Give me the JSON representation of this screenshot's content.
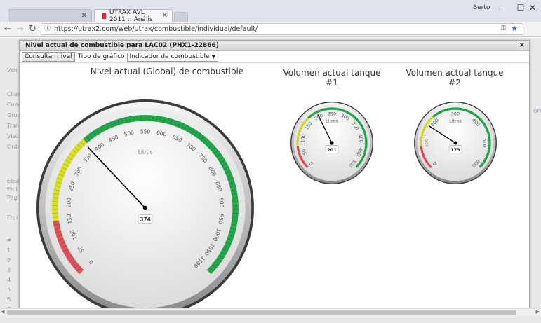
{
  "browser": {
    "tabs": [
      {
        "label": ""
      },
      {
        "label": "UTRAX AVL 2011 :: Anális"
      }
    ],
    "user": "Berto",
    "url": "https://utrax2.com/web/utrax/combustible/individual/default/"
  },
  "modal": {
    "title": "Nivel actual de combustible para LAC02 (PHX1-22866)",
    "close": "×",
    "toolbar": {
      "button": "Consultar nivel",
      "chart_type_label": "Tipo de gráfico",
      "chart_type_value": "Indicador de combustible"
    }
  },
  "background": {
    "items": [
      "Veh",
      "Clien",
      "Cuen",
      "Grup",
      "Tran",
      "Vista",
      "Orde",
      "Equi",
      "En l",
      "Pági",
      "Equ",
      "#",
      "1",
      "2",
      "3",
      "4",
      "5",
      "6",
      "7"
    ],
    "right_label": "OPERACIÓN"
  },
  "chart_data": [
    {
      "type": "gauge",
      "title": "Nivel actual (Global) de combustible",
      "unit_label": "Litros",
      "value": 374,
      "min": 0,
      "max": 1100,
      "ticks": [
        0,
        50,
        100,
        150,
        200,
        250,
        300,
        350,
        400,
        450,
        500,
        550,
        600,
        650,
        700,
        750,
        800,
        850,
        900,
        950,
        1000,
        1050,
        1100
      ],
      "bands": [
        {
          "from": 0,
          "to": 150,
          "color": "#e0525a"
        },
        {
          "from": 150,
          "to": 380,
          "color": "#d7df2a"
        },
        {
          "from": 380,
          "to": 1100,
          "color": "#22a84a"
        }
      ]
    },
    {
      "type": "gauge",
      "title": "Volumen actual tanque #1",
      "unit_label": "Litros",
      "value": 201,
      "min": 0,
      "max": 500,
      "ticks": [
        0,
        50,
        100,
        150,
        200,
        250,
        300,
        350,
        400,
        450,
        500
      ],
      "bands": [
        {
          "from": 0,
          "to": 75,
          "color": "#e0525a"
        },
        {
          "from": 75,
          "to": 170,
          "color": "#d7df2a"
        },
        {
          "from": 170,
          "to": 500,
          "color": "#22a84a"
        }
      ]
    },
    {
      "type": "gauge",
      "title": "Volumen actual tanque #2",
      "unit_label": "Litros",
      "value": 173,
      "min": 0,
      "max": 600,
      "ticks": [
        0,
        100,
        200,
        300,
        400,
        500,
        600
      ],
      "bands": [
        {
          "from": 0,
          "to": 90,
          "color": "#e0525a"
        },
        {
          "from": 90,
          "to": 210,
          "color": "#d7df2a"
        },
        {
          "from": 210,
          "to": 600,
          "color": "#22a84a"
        }
      ]
    }
  ]
}
